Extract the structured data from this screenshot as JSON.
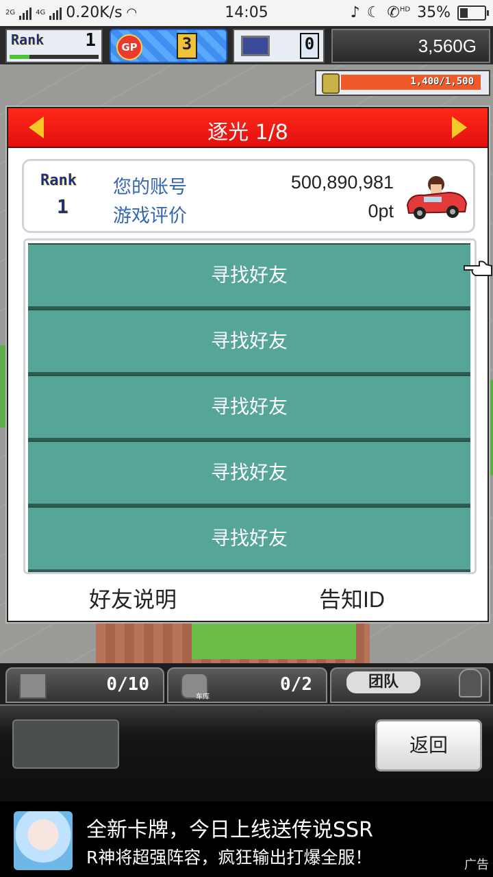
{
  "status_bar": {
    "net_types": [
      "2G",
      "4G"
    ],
    "speed": "0.20K/s",
    "time": "14:05",
    "hd_label": "HD",
    "battery": "35%",
    "battery_level": 0.35
  },
  "hud": {
    "rank_label": "Rank",
    "rank_value": "1",
    "gp_label": "GP",
    "gp_value": "3",
    "pc_value": "0",
    "money": "3,560G",
    "funds": "1,400/1,500"
  },
  "dialog": {
    "title": "逐光 1/8",
    "info": {
      "rank_label": "Rank",
      "rank_value": "1",
      "account_label": "您的账号",
      "account_value": "500,890,981",
      "rating_label": "游戏评价",
      "rating_value": "0pt"
    },
    "friend_slots": [
      "寻找好友",
      "寻找好友",
      "寻找好友",
      "寻找好友",
      "寻找好友"
    ],
    "footer": {
      "explain": "好友说明",
      "notify_id": "告知ID"
    }
  },
  "tray": {
    "storage_count": "0/10",
    "garage_count": "0/2",
    "garage_label": "车库",
    "team_label": "团队"
  },
  "console": {
    "back_label": "返回"
  },
  "ad": {
    "title": "全新卡牌，今日上线送传说SSR",
    "subtitle": "R神将超强阵容，疯狂输出打爆全服！",
    "tag": "广告"
  }
}
